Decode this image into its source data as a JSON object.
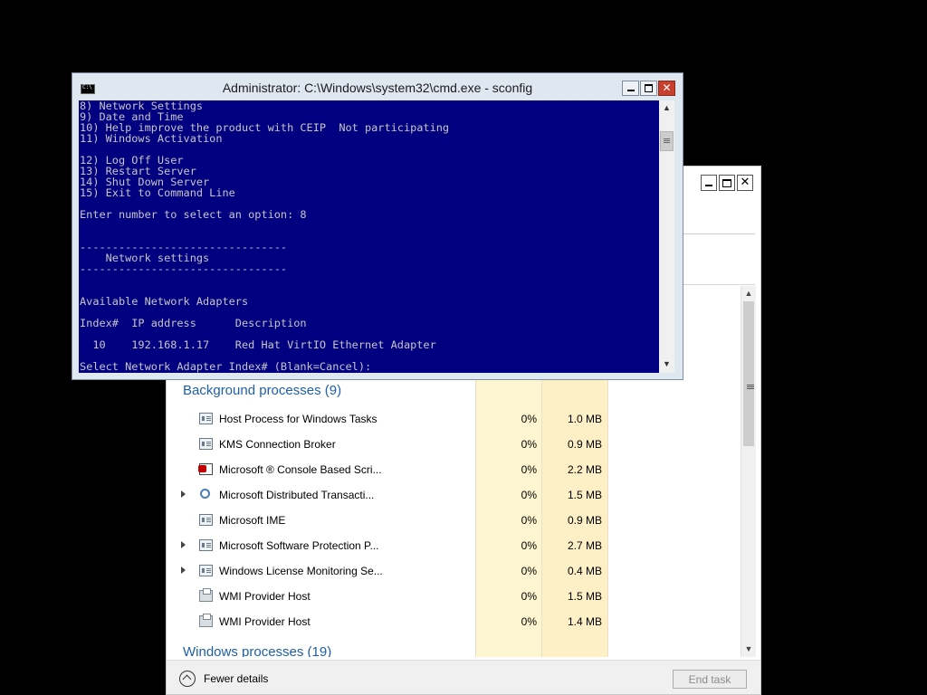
{
  "task_manager": {
    "groups": {
      "background": "Background processes (9)",
      "windows": "Windows processes (19)"
    },
    "processes": [
      {
        "name": "Host Process for Windows Tasks",
        "cpu": "0%",
        "memory": "1.0 MB",
        "icon": "generic-app-icon",
        "expandable": false
      },
      {
        "name": "KMS Connection Broker",
        "cpu": "0%",
        "memory": "0.9 MB",
        "icon": "generic-app-icon",
        "expandable": false
      },
      {
        "name": "Microsoft ® Console Based Scri...",
        "cpu": "0%",
        "memory": "2.2 MB",
        "icon": "script-host-icon",
        "expandable": false
      },
      {
        "name": "Microsoft Distributed Transacti...",
        "cpu": "0%",
        "memory": "1.5 MB",
        "icon": "network-service-icon",
        "expandable": true
      },
      {
        "name": "Microsoft IME",
        "cpu": "0%",
        "memory": "0.9 MB",
        "icon": "generic-app-icon",
        "expandable": false
      },
      {
        "name": "Microsoft Software Protection P...",
        "cpu": "0%",
        "memory": "2.7 MB",
        "icon": "generic-app-icon",
        "expandable": true
      },
      {
        "name": "Windows License Monitoring Se...",
        "cpu": "0%",
        "memory": "0.4 MB",
        "icon": "generic-app-icon",
        "expandable": true
      },
      {
        "name": "WMI Provider Host",
        "cpu": "0%",
        "memory": "1.5 MB",
        "icon": "wmi-host-icon",
        "expandable": false
      },
      {
        "name": "WMI Provider Host",
        "cpu": "0%",
        "memory": "1.4 MB",
        "icon": "wmi-host-icon",
        "expandable": false
      }
    ],
    "footer": {
      "fewer_details": "Fewer details",
      "end_task": "End task"
    },
    "colors": {
      "group_header": "#1f5fa8",
      "cpu_column": "#fdf5d0",
      "memory_column": "#fdf0c6"
    }
  },
  "cmd": {
    "title": "Administrator: C:\\Windows\\system32\\cmd.exe - sconfig",
    "console_lines": [
      "8) Network Settings",
      "9) Date and Time",
      "10) Help improve the product with CEIP  Not participating",
      "11) Windows Activation",
      "",
      "12) Log Off User",
      "13) Restart Server",
      "14) Shut Down Server",
      "15) Exit to Command Line",
      "",
      "Enter number to select an option: 8",
      "",
      "",
      "--------------------------------",
      "    Network settings",
      "--------------------------------",
      "",
      "",
      "Available Network Adapters",
      "",
      "Index#  IP address      Description",
      "",
      "  10    192.168.1.17    Red Hat VirtIO Ethernet Adapter",
      "",
      "Select Network Adapter Index# (Blank=Cancel):"
    ],
    "colors": {
      "background": "#000080",
      "text": "#c6c6c6"
    }
  }
}
